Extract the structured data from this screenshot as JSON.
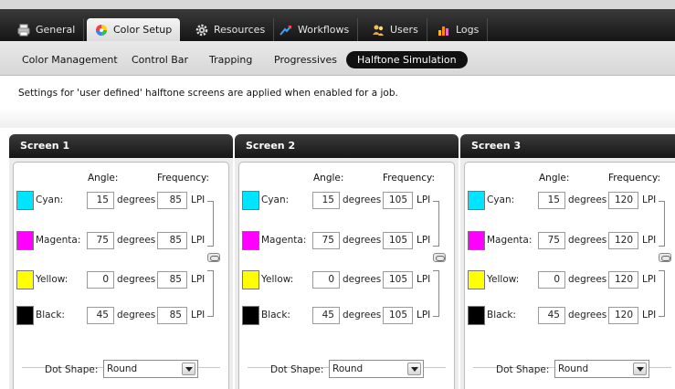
{
  "tabs": [
    {
      "label": "General",
      "icon": "printer-icon"
    },
    {
      "label": "Color Setup",
      "icon": "color-wheel-icon"
    },
    {
      "label": "Resources",
      "icon": "gear-icon"
    },
    {
      "label": "Workflows",
      "icon": "arrows-icon"
    },
    {
      "label": "Users",
      "icon": "users-icon"
    },
    {
      "label": "Logs",
      "icon": "bar-chart-icon"
    }
  ],
  "active_tab": "Color Setup",
  "subtabs": [
    "Color Management",
    "Control Bar",
    "Trapping",
    "Progressives",
    "Halftone Simulation"
  ],
  "active_subtab": "Halftone Simulation",
  "description": "Settings for 'user defined' halftone screens are applied when enabled for a job.",
  "labels": {
    "angle": "Angle:",
    "frequency": "Frequency:",
    "degrees": "degrees",
    "lpi": "LPI",
    "dot_shape": "Dot Shape:"
  },
  "ink_colors": {
    "cyan": "#00e5ff",
    "magenta": "#ff00ff",
    "yellow": "#ffff00",
    "black": "#000000"
  },
  "screens": [
    {
      "title": "Screen 1",
      "inks": [
        {
          "name": "Cyan:",
          "angle": "15",
          "frequency": "85"
        },
        {
          "name": "Magenta:",
          "angle": "75",
          "frequency": "85"
        },
        {
          "name": "Yellow:",
          "angle": "0",
          "frequency": "85"
        },
        {
          "name": "Black:",
          "angle": "45",
          "frequency": "85"
        }
      ],
      "dot_shape": "Round"
    },
    {
      "title": "Screen 2",
      "inks": [
        {
          "name": "Cyan:",
          "angle": "15",
          "frequency": "105"
        },
        {
          "name": "Magenta:",
          "angle": "75",
          "frequency": "105"
        },
        {
          "name": "Yellow:",
          "angle": "0",
          "frequency": "105"
        },
        {
          "name": "Black:",
          "angle": "45",
          "frequency": "105"
        }
      ],
      "dot_shape": "Round"
    },
    {
      "title": "Screen 3",
      "inks": [
        {
          "name": "Cyan:",
          "angle": "15",
          "frequency": "120"
        },
        {
          "name": "Magenta:",
          "angle": "75",
          "frequency": "120"
        },
        {
          "name": "Yellow:",
          "angle": "0",
          "frequency": "120"
        },
        {
          "name": "Black:",
          "angle": "45",
          "frequency": "120"
        }
      ],
      "dot_shape": "Round"
    }
  ]
}
